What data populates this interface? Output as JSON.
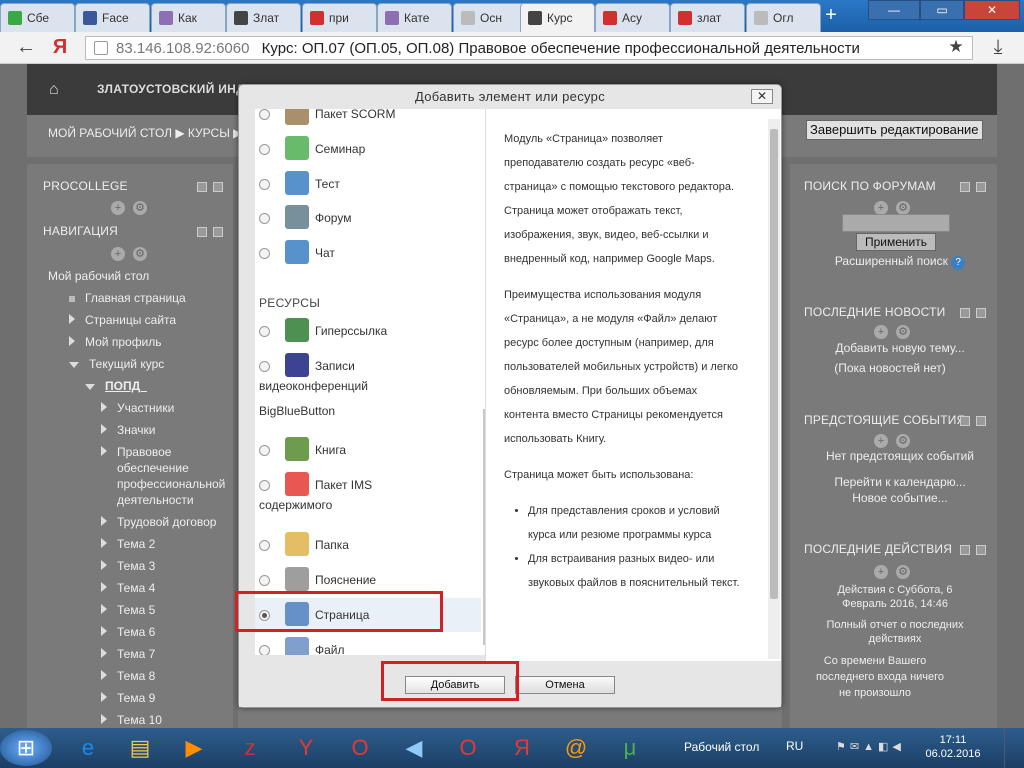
{
  "browser": {
    "tabs": [
      {
        "label": "Сбе",
        "color": "#3aa845"
      },
      {
        "label": "Face",
        "color": "#3b5998"
      },
      {
        "label": "Как",
        "color": "#8e6fb3"
      },
      {
        "label": "Злат",
        "color": "#444444"
      },
      {
        "label": "при",
        "color": "#d32f2f"
      },
      {
        "label": "Кате",
        "color": "#8e6fb3"
      },
      {
        "label": "Осн",
        "color": "#bbbbbb"
      },
      {
        "label": "Курс",
        "color": "#444444",
        "active": true
      },
      {
        "label": "Асу",
        "color": "#d32f2f"
      },
      {
        "label": "злат",
        "color": "#d32f2f"
      },
      {
        "label": "Огл",
        "color": "#bbbbbb"
      }
    ],
    "new_tab": "+",
    "window_buttons": [
      "—",
      "▭",
      "✕"
    ],
    "url_host": "83.146.108.92:6060",
    "page_title": "Курс: ОП.07 (ОП.05, ОП.08) Правовое обеспечение профессиональной деятельности",
    "yandex_glyph": "Я",
    "back_glyph": "←",
    "star_glyph": "★",
    "download_glyph": "⤓"
  },
  "site": {
    "name": "ЗЛАТОУСТОВСКИЙ ИНДУС",
    "breadcrumb": "МОЙ РАБОЧИЙ СТОЛ ▶ КУРСЫ ▶",
    "finish_button": "Завершить редактирование"
  },
  "left_blocks": {
    "procollege": "PROCOLLEGE",
    "navigation": "НАВИГАЦИЯ",
    "nav_items": [
      {
        "label": "Мой рабочий стол",
        "level": 0,
        "marker": "none"
      },
      {
        "label": "Главная страница",
        "level": 1,
        "marker": "square"
      },
      {
        "label": "Страницы сайта",
        "level": 1,
        "marker": "tri"
      },
      {
        "label": "Мой профиль",
        "level": 1,
        "marker": "tri"
      },
      {
        "label": "Текущий курс",
        "level": 1,
        "marker": "trid"
      },
      {
        "label": "ПОПД_",
        "level": 2,
        "marker": "trid"
      },
      {
        "label": "Участники",
        "level": 3,
        "marker": "tri"
      },
      {
        "label": "Значки",
        "level": 3,
        "marker": "tri"
      },
      {
        "label": "Правовое",
        "level": 3,
        "marker": "tri"
      },
      {
        "label": "обеспечение",
        "level": 3,
        "marker": "none"
      },
      {
        "label": "профессиональной",
        "level": 3,
        "marker": "none"
      },
      {
        "label": "деятельности",
        "level": 3,
        "marker": "none"
      },
      {
        "label": "Трудовой договор",
        "level": 3,
        "marker": "tri"
      },
      {
        "label": "Тема 2",
        "level": 3,
        "marker": "tri"
      },
      {
        "label": "Тема 3",
        "level": 3,
        "marker": "tri"
      },
      {
        "label": "Тема 4",
        "level": 3,
        "marker": "tri"
      },
      {
        "label": "Тема 5",
        "level": 3,
        "marker": "tri"
      },
      {
        "label": "Тема 6",
        "level": 3,
        "marker": "tri"
      },
      {
        "label": "Тема 7",
        "level": 3,
        "marker": "tri"
      },
      {
        "label": "Тема 8",
        "level": 3,
        "marker": "tri"
      },
      {
        "label": "Тема 9",
        "level": 3,
        "marker": "tri"
      },
      {
        "label": "Тема 10",
        "level": 3,
        "marker": "tri"
      }
    ]
  },
  "right_blocks": {
    "forum_search": {
      "title": "ПОИСК ПО ФОРУМАМ",
      "button": "Применить",
      "advanced": "Расширенный поиск"
    },
    "news": {
      "title": "ПОСЛЕДНИЕ НОВОСТИ",
      "add": "Добавить новую тему...",
      "empty": "(Пока новостей нет)"
    },
    "events": {
      "title": "ПРЕДСТОЯЩИЕ СОБЫТИЯ",
      "none": "Нет предстоящих событий",
      "calendar": "Перейти к календарю...",
      "new_event": "Новое событие..."
    },
    "activity": {
      "title": "ПОСЛЕДНИЕ ДЕЙСТВИЯ",
      "since1": "Действия с Суббота, 6",
      "since2": "Февраль 2016, 14:46",
      "report1": "Полный отчет о последних",
      "report2": "действиях",
      "nothing1": "Со времени Вашего",
      "nothing2": "последнего входа ничего",
      "nothing3": "не произошло"
    }
  },
  "modal": {
    "title": "Добавить элемент или ресурс",
    "close": "✕",
    "section_resources": "РЕСУРСЫ",
    "activities": [
      {
        "label": "Пакет SCORM",
        "icon": "scorm-icon",
        "color": "#9a7b50"
      },
      {
        "label": "Семинар",
        "icon": "flask-icon",
        "color": "#4caf50"
      },
      {
        "label": "Тест",
        "icon": "checklist-icon",
        "color": "#3b7fc4"
      },
      {
        "label": "Форум",
        "icon": "forum-icon",
        "color": "#607d8b"
      },
      {
        "label": "Чат",
        "icon": "chat-icon",
        "color": "#3b7fc4"
      }
    ],
    "resources": [
      {
        "label": "Гиперссылка",
        "icon": "globe-link-icon",
        "color": "#2e7d32"
      },
      {
        "label": "Записи",
        "wrap": [
          "видеоконференций",
          "BigBlueButton"
        ],
        "icon": "bigbluebutton-icon",
        "color": "#1a237e"
      },
      {
        "label": "Книга",
        "icon": "book-icon",
        "color": "#558b2f"
      },
      {
        "label": "Пакет IMS",
        "wrap": [
          "содержимого"
        ],
        "icon": "ims-package-icon",
        "color": "#e53935"
      },
      {
        "label": "Папка",
        "icon": "folder-icon",
        "color": "#e0b14a"
      },
      {
        "label": "Пояснение",
        "icon": "label-icon",
        "color": "#8d8d8d"
      },
      {
        "label": "Страница",
        "icon": "page-icon",
        "color": "#4f7fc0",
        "selected": true
      },
      {
        "label": "Файл",
        "icon": "file-icon",
        "color": "#6a8ec6"
      }
    ],
    "description": {
      "p1": "Модуль «Страница» позволяет преподавателю создать ресурс «веб-страница» с помощью текстового редактора. Страница может отображать текст, изображения, звук, видео, веб-ссылки и внедренный код, например Google Maps.",
      "p2": "Преимущества использования модуля «Страница», а не модуля «Файл» делают ресурс более доступным (например, для пользователей мобильных устройств) и легко обновляемым. При больших объемах контента вместо Страницы рекомендуется использовать Книгу.",
      "p3": "Страница может быть использована:",
      "li1": "Для представления сроков и условий курса или резюме программы курса",
      "li2": "Для встраивания разных видео- или звуковых файлов в пояснительный текст."
    },
    "add_button": "Добавить",
    "cancel_button": "Отмена"
  },
  "taskbar": {
    "apps": [
      {
        "name": "start-button",
        "glyph": "⊞",
        "color": "#1e88e5"
      },
      {
        "name": "ie-icon",
        "glyph": "e",
        "color": "#1e88e5"
      },
      {
        "name": "explorer-icon",
        "glyph": "▤",
        "color": "#f2c94c"
      },
      {
        "name": "media-player-icon",
        "glyph": "▶",
        "color": "#ff8f00"
      },
      {
        "name": "zynga-icon",
        "glyph": "z",
        "color": "#d32f2f"
      },
      {
        "name": "yandex-browser-icon",
        "glyph": "Y",
        "color": "#e53935"
      },
      {
        "name": "opera-icon",
        "glyph": "O",
        "color": "#e53935"
      },
      {
        "name": "speaker-icon",
        "glyph": "◀",
        "color": "#90caf9"
      },
      {
        "name": "opera-icon-2",
        "glyph": "O",
        "color": "#e53935"
      },
      {
        "name": "yandex-icon",
        "glyph": "Я",
        "color": "#e53935"
      },
      {
        "name": "mail-agent-icon",
        "glyph": "@",
        "color": "#ff9800"
      },
      {
        "name": "utorrent-icon",
        "glyph": "μ",
        "color": "#4caf50"
      }
    ],
    "desktop_label": "Рабочий стол",
    "lang": "RU",
    "time": "17:11",
    "date": "06.02.2016"
  }
}
